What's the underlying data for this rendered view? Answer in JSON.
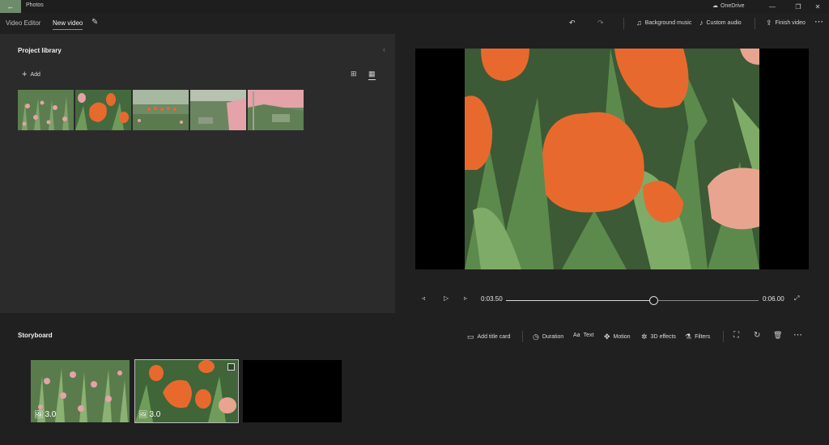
{
  "titlebar": {
    "back_icon": "←",
    "app_title": "Photos",
    "onedrive_label": "OneDrive",
    "onedrive_icon": "☁",
    "minimize_icon": "—",
    "maximize_icon": "❐",
    "close_icon": "✕"
  },
  "commandbar": {
    "breadcrumb_root": "Video Editor",
    "project_name": "New video",
    "rename_icon": "✎",
    "undo_icon": "↶",
    "redo_icon": "↷",
    "background_music_icon": "♫",
    "background_music": "Background music",
    "custom_audio_icon": "♪",
    "custom_audio": "Custom audio",
    "finish_video_icon": "⇪",
    "finish_video": "Finish video",
    "more_icon": "⋯"
  },
  "library": {
    "title": "Project library",
    "collapse_icon": "‹",
    "add_icon": "+",
    "add_label": "Add",
    "grid_large_icon": "⊞",
    "grid_small_icon": "▦"
  },
  "player": {
    "prev_icon": "◃",
    "play_icon": "▷",
    "next_icon": "▹",
    "current_time": "0:03.50",
    "total_time": "0:06.00",
    "progress": 0.583,
    "fullscreen_icon": "⤢"
  },
  "storyboard": {
    "title": "Storyboard",
    "add_title_card_icon": "▭",
    "add_title_card": "Add title card",
    "duration_icon": "◷",
    "duration": "Duration",
    "text_icon": "Aa",
    "text": "Text",
    "motion_icon": "✥",
    "motion": "Motion",
    "effects_icon": "✲",
    "effects": "3D effects",
    "filters_icon": "⚗",
    "filters": "Filters",
    "crop_icon": "⛶",
    "rotate_icon": "↻",
    "delete_icon": "🗑",
    "more_icon": "⋯",
    "clips": [
      {
        "duration": "3.0",
        "icon": "🖼"
      },
      {
        "duration": "3.0",
        "icon": "🖼"
      }
    ]
  },
  "colors": {
    "accent": "#6e8c6b",
    "tulip_orange": "#e8692e",
    "leaf_green": "#4f7a45",
    "pink": "#e4a3a8"
  }
}
